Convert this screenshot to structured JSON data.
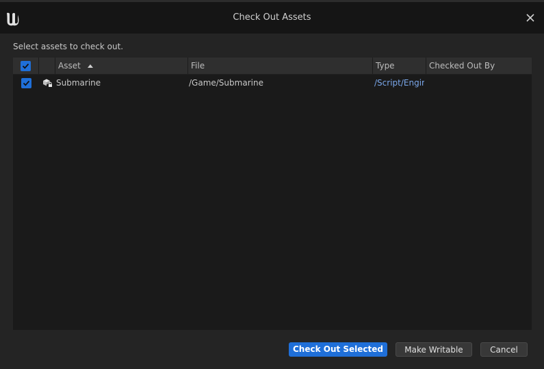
{
  "window": {
    "title": "Check Out Assets"
  },
  "instruction": "Select assets to check out.",
  "table": {
    "columns": [
      "",
      "",
      "Asset",
      "File",
      "Type",
      "Checked Out By"
    ],
    "sort_column": "Asset",
    "sort_direction": "ascending",
    "rows": [
      {
        "checked": true,
        "icon": "asset-locked-icon",
        "asset": "Submarine",
        "file": "/Game/Submarine",
        "type": "/Script/Engir",
        "checked_out_by": ""
      }
    ]
  },
  "buttons": {
    "check_out_selected": "Check Out Selected",
    "make_writable": "Make Writable",
    "cancel": "Cancel"
  },
  "colors": {
    "accent": "#1f6fd8",
    "link": "#7aa7ea",
    "background": "#242424",
    "table_background": "#1a1a1a",
    "header_background": "#2f2f2f"
  }
}
